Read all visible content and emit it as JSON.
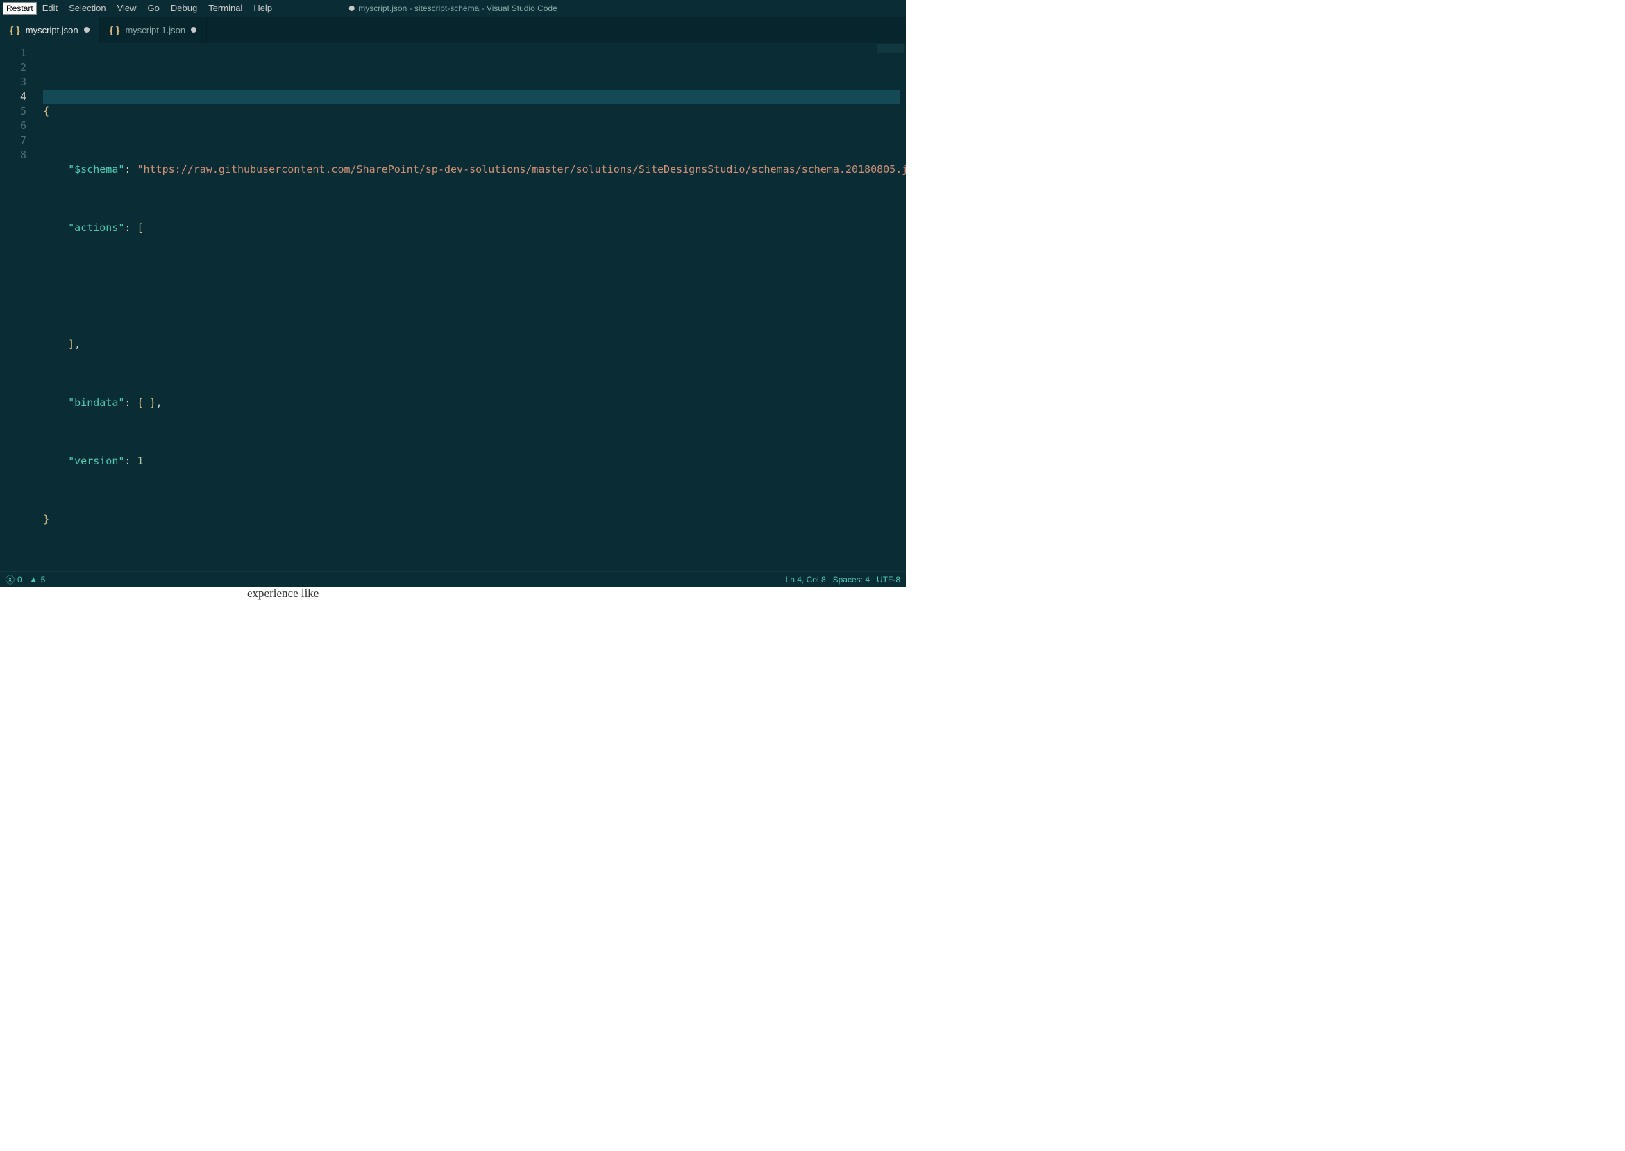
{
  "menubar": {
    "restart_label": "Restart",
    "items": [
      "Edit",
      "Selection",
      "View",
      "Go",
      "Debug",
      "Terminal",
      "Help"
    ]
  },
  "window_title": "myscript.json - sitescript-schema - Visual Studio Code",
  "tabs": [
    {
      "label": "myscript.json",
      "dirty": true,
      "active": true
    },
    {
      "label": "myscript.1.json",
      "dirty": true,
      "active": false
    }
  ],
  "editor": {
    "current_line": 4,
    "line_numbers": [
      "1",
      "2",
      "3",
      "4",
      "5",
      "6",
      "7",
      "8"
    ],
    "code": {
      "schema_key": "\"$schema\"",
      "schema_url": "https://raw.githubusercontent.com/SharePoint/sp-dev-solutions/master/solutions/SiteDesignsStudio/schemas/schema.20180805.j",
      "actions_key": "\"actions\"",
      "bindata_key": "\"bindata\"",
      "version_key": "\"version\"",
      "version_val": "1"
    }
  },
  "statusbar": {
    "errors": "0",
    "warnings": "5",
    "ln_col": "Ln 4, Col 8",
    "spaces": "Spaces: 4",
    "encoding": "UTF-8"
  },
  "leaked_text": "experience like"
}
